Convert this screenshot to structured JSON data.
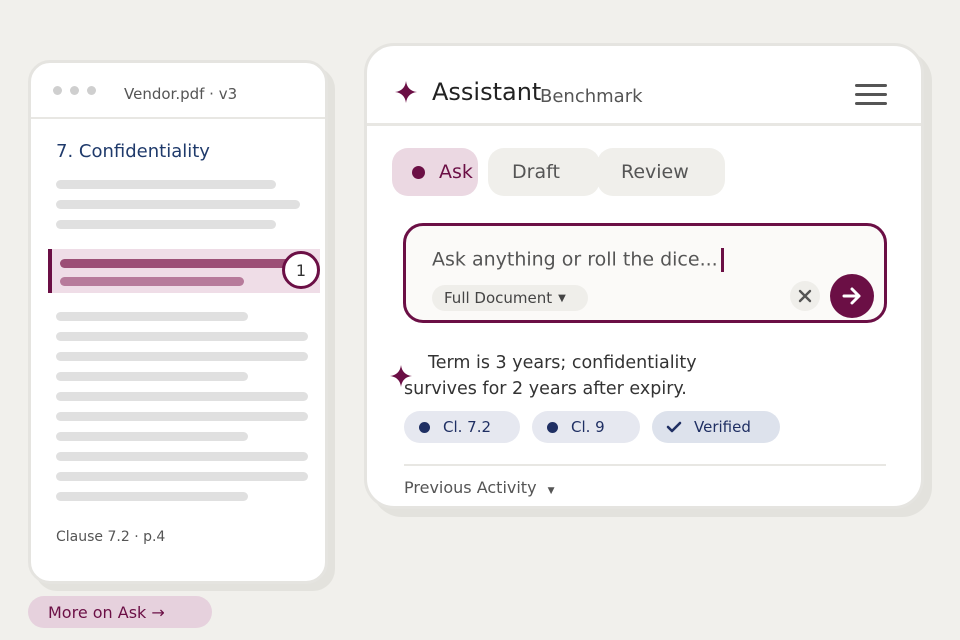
{
  "document": {
    "title": "Vendor.pdf · v3",
    "heading": "7. Confidentiality",
    "highlight_badge": "1",
    "footer": "Clause 7.2 · p.4"
  },
  "more_link": "More on Ask →",
  "assistant": {
    "title": "Assistant",
    "subtitle": "Benchmark",
    "tabs": [
      {
        "label": "Ask",
        "active": true
      },
      {
        "label": "Draft",
        "active": false
      },
      {
        "label": "Review",
        "active": false
      }
    ],
    "input": {
      "placeholder": "Ask anything or roll the dice...",
      "scope": "Full Document"
    },
    "answer": {
      "line1": "Term is 3 years; confidentiality",
      "line2": "survives for 2 years after expiry."
    },
    "citations": [
      "Cl. 7.2",
      "Cl. 9"
    ],
    "verified_label": "Verified",
    "previous_activity": "Previous Activity"
  },
  "colors": {
    "accent": "#6b0f45",
    "citation": "#1f2f63",
    "background": "#f1f0ec"
  },
  "icons": [
    "sparkle-icon",
    "menu-icon",
    "close-icon",
    "arrow-right-icon",
    "check-icon",
    "caret-down-icon"
  ]
}
